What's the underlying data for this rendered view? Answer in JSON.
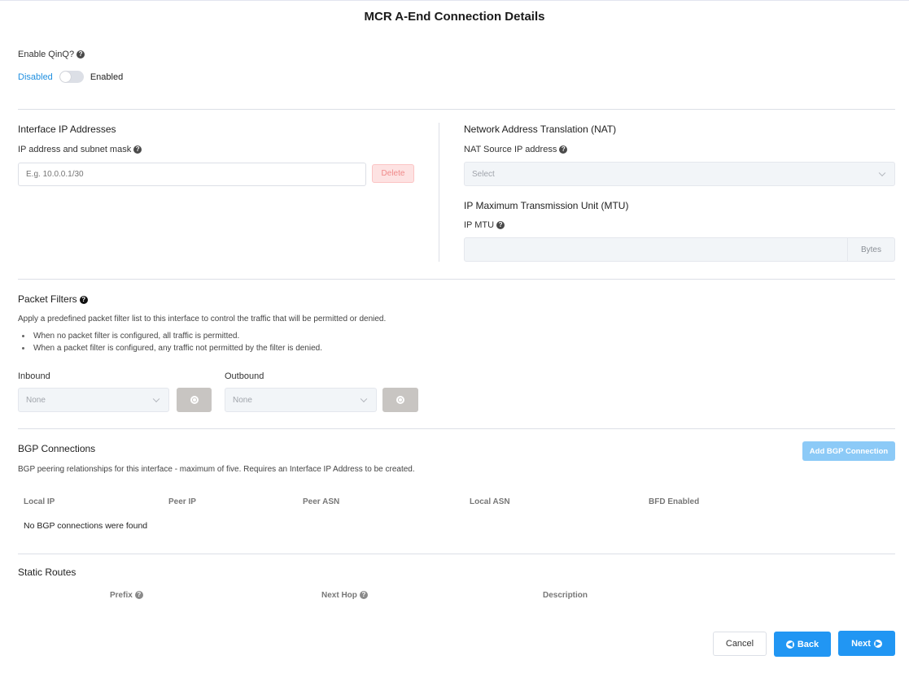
{
  "page": {
    "title": "MCR A-End Connection Details"
  },
  "qinq": {
    "label": "Enable QinQ?",
    "help_icon": "question-circle-icon",
    "off_label": "Disabled",
    "on_label": "Enabled",
    "enabled": false
  },
  "interface_ip": {
    "heading": "Interface IP Addresses",
    "field_label": "IP address and subnet mask",
    "placeholder": "E.g. 10.0.0.1/30",
    "value": "",
    "delete_label": "Delete"
  },
  "nat": {
    "heading": "Network Address Translation (NAT)",
    "field_label": "NAT Source IP address",
    "select_placeholder": "Select"
  },
  "mtu": {
    "heading": "IP Maximum Transmission Unit (MTU)",
    "field_label": "IP MTU",
    "value": "",
    "suffix": "Bytes"
  },
  "packet_filters": {
    "heading": "Packet Filters",
    "description": "Apply a predefined packet filter list to this interface to control the traffic that will be permitted or denied.",
    "bullets": [
      "When no packet filter is configured, all traffic is permitted.",
      "When a packet filter is configured, any traffic not permitted by the filter is denied."
    ],
    "inbound": {
      "label": "Inbound",
      "value": "None",
      "view_icon": "eye-icon"
    },
    "outbound": {
      "label": "Outbound",
      "value": "None",
      "view_icon": "eye-icon"
    }
  },
  "bgp": {
    "heading": "BGP Connections",
    "description": "BGP peering relationships for this interface - maximum of five. Requires an Interface IP Address to be created.",
    "add_button": "Add BGP Connection",
    "columns": [
      "Local IP",
      "Peer IP",
      "Peer ASN",
      "Local ASN",
      "BFD Enabled"
    ],
    "rows": [],
    "empty_message": "No BGP connections were found"
  },
  "static_routes": {
    "heading": "Static Routes",
    "columns": [
      {
        "label": "Prefix",
        "help": true
      },
      {
        "label": "Next Hop",
        "help": true
      },
      {
        "label": "Description",
        "help": false
      }
    ]
  },
  "footer": {
    "cancel_label": "Cancel",
    "back_label": "Back",
    "next_label": "Next"
  },
  "colors": {
    "primary": "#2196f3",
    "primary_disabled": "#8ccaf7",
    "danger_bg": "#fde2e2",
    "danger_text": "#f08a8a",
    "toggle_active_label": "#1f8fe0"
  }
}
